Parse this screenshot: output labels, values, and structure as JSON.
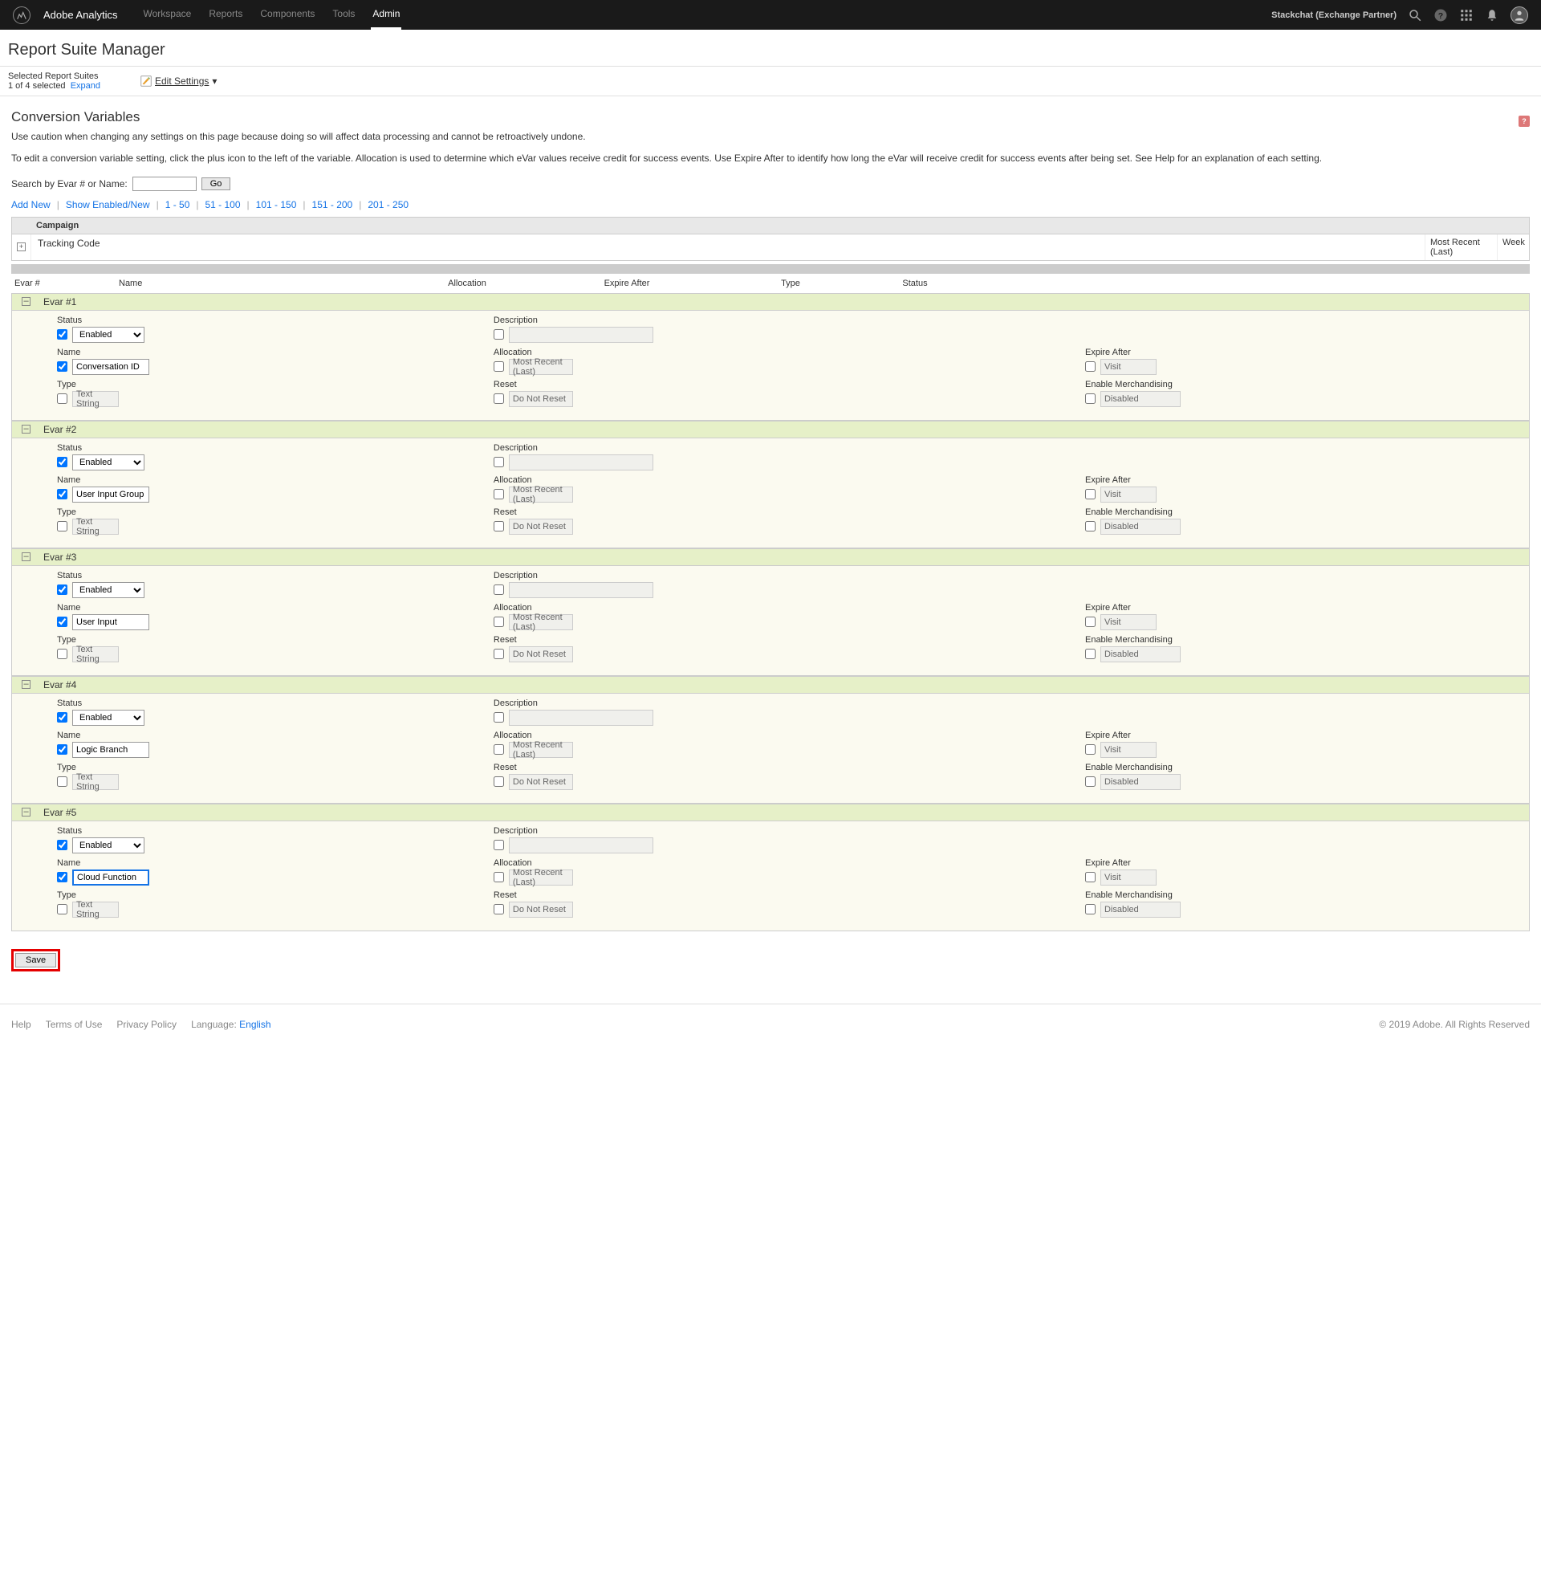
{
  "nav": {
    "brand": "Adobe Analytics",
    "items": [
      "Workspace",
      "Reports",
      "Components",
      "Tools",
      "Admin"
    ],
    "active": 4,
    "company": "Stackchat (Exchange Partner)"
  },
  "page_title": "Report Suite Manager",
  "subheader": {
    "selected_label": "Selected Report Suites",
    "selected_count": "1 of 4 selected",
    "expand_link": "Expand",
    "edit_settings": "Edit Settings"
  },
  "section": {
    "title": "Conversion Variables",
    "warning": "Use caution when changing any settings on this page because doing so will affect data processing and cannot be retroactively undone.",
    "info": "To edit a conversion variable setting, click the plus icon to the left of the variable. Allocation is used to determine which eVar values receive credit for success events. Use Expire After to identify how long the eVar will receive credit for success events after being set. See Help for an explanation of each setting."
  },
  "search": {
    "label": "Search by Evar # or Name:",
    "go": "Go"
  },
  "links": [
    "Add New",
    "Show Enabled/New",
    "1 - 50",
    "51 - 100",
    "101 - 150",
    "151 - 200",
    "201 - 250"
  ],
  "campaign": {
    "header": "Campaign",
    "tracking": "Tracking Code",
    "mrl": "Most Recent (Last)",
    "week": "Week"
  },
  "cols": {
    "evar": "Evar #",
    "name": "Name",
    "allocation": "Allocation",
    "expire": "Expire After",
    "type": "Type",
    "status": "Status"
  },
  "labels": {
    "status": "Status",
    "name": "Name",
    "type": "Type",
    "description": "Description",
    "allocation": "Allocation",
    "reset": "Reset",
    "expire_after": "Expire After",
    "enable_merch": "Enable Merchandising"
  },
  "defaults": {
    "enabled": "Enabled",
    "text_string": "Text String",
    "most_recent": "Most Recent (Last)",
    "do_not_reset": "Do Not Reset",
    "visit": "Visit",
    "disabled": "Disabled"
  },
  "evars": [
    {
      "header": "Evar #1",
      "name": "Conversation ID",
      "focused": false
    },
    {
      "header": "Evar #2",
      "name": "User Input Group",
      "focused": false
    },
    {
      "header": "Evar #3",
      "name": "User Input",
      "focused": false
    },
    {
      "header": "Evar #4",
      "name": "Logic Branch",
      "focused": false
    },
    {
      "header": "Evar #5",
      "name": "Cloud Function",
      "focused": true
    }
  ],
  "save": "Save",
  "footer": {
    "help": "Help",
    "terms": "Terms of Use",
    "privacy": "Privacy Policy",
    "lang_label": "Language:",
    "lang_value": "English",
    "copyright": "© 2019 Adobe. All Rights Reserved"
  }
}
